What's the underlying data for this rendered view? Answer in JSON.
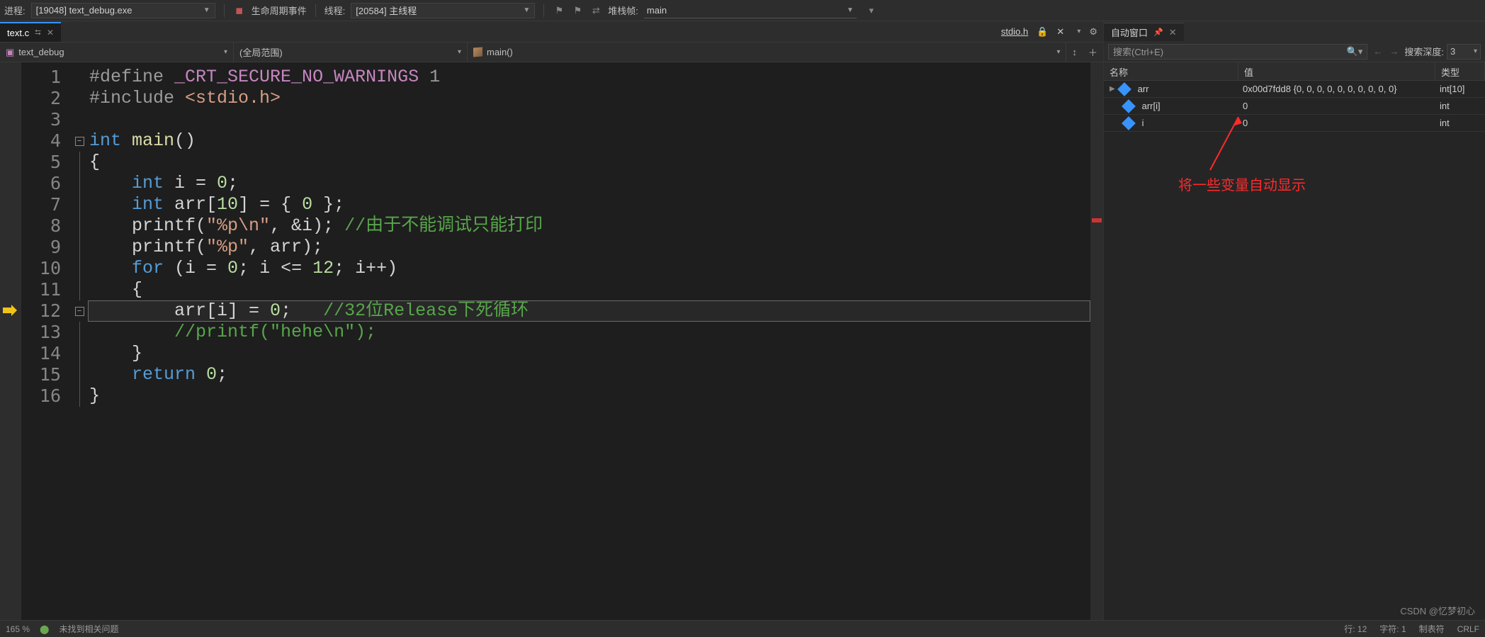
{
  "toolbar": {
    "process_label": "进程:",
    "process_value": "[19048] text_debug.exe",
    "lifecycle_label": "生命周期事件",
    "thread_label": "线程:",
    "thread_value": "[20584] 主线程",
    "stack_label": "堆栈帧:",
    "stack_value": "main"
  },
  "tab": {
    "filename": "text.c",
    "right_file": "stdio.h"
  },
  "nav": {
    "project": "text_debug",
    "scope": "(全局范围)",
    "func": "main()"
  },
  "code": {
    "lines": [
      {
        "n": "1"
      },
      {
        "n": "2"
      },
      {
        "n": "3"
      },
      {
        "n": "4"
      },
      {
        "n": "5"
      },
      {
        "n": "6"
      },
      {
        "n": "7"
      },
      {
        "n": "8"
      },
      {
        "n": "9"
      },
      {
        "n": "10"
      },
      {
        "n": "11"
      },
      {
        "n": "12"
      },
      {
        "n": "13"
      },
      {
        "n": "14"
      },
      {
        "n": "15"
      },
      {
        "n": "16"
      }
    ],
    "l1_a": "#define ",
    "l1_b": "_CRT_SECURE_NO_WARNINGS",
    "l1_c": " 1",
    "l2_a": "#include ",
    "l2_b": "<stdio.h>",
    "l4_a": "int",
    "l4_b": " main",
    "l4_c": "()",
    "l5": "{",
    "l6_a": "    ",
    "l6_b": "int",
    "l6_c": " i = ",
    "l6_d": "0",
    "l6_e": ";",
    "l7_a": "    ",
    "l7_b": "int",
    "l7_c": " arr[",
    "l7_d": "10",
    "l7_e": "] = { ",
    "l7_f": "0",
    "l7_g": " };",
    "l8_a": "    printf(",
    "l8_b": "\"%p\\n\"",
    "l8_c": ", &i); ",
    "l8_d": "//由于不能调试只能打印",
    "l9_a": "    printf(",
    "l9_b": "\"%p\"",
    "l9_c": ", arr);",
    "l10_a": "    ",
    "l10_b": "for",
    "l10_c": " (i = ",
    "l10_d": "0",
    "l10_e": "; i <= ",
    "l10_f": "12",
    "l10_g": "; i++)",
    "l11": "    {",
    "l12_a": "        arr[i] = ",
    "l12_b": "0",
    "l12_c": ";   ",
    "l12_d": "//32位Release下死循环",
    "l13_a": "        ",
    "l13_b": "//printf(\"hehe\\n\");",
    "l14": "    }",
    "l15_a": "    ",
    "l15_b": "return",
    "l15_c": " ",
    "l15_d": "0",
    "l15_e": ";",
    "l16": "}"
  },
  "autos": {
    "title": "自动窗口",
    "search_ph": "搜索(Ctrl+E)",
    "depth_label": "搜索深度:",
    "depth_value": "3",
    "cols": {
      "name": "名称",
      "value": "值",
      "type": "类型"
    },
    "rows": [
      {
        "expand": true,
        "name": "arr",
        "value": "0x00d7fdd8 {0, 0, 0, 0, 0, 0, 0, 0, 0, 0}",
        "type": "int[10]"
      },
      {
        "expand": false,
        "name": "arr[i]",
        "value": "0",
        "type": "int"
      },
      {
        "expand": false,
        "name": "i",
        "value": "0",
        "type": "int"
      }
    ]
  },
  "annotation": "将一些变量自动显示",
  "status": {
    "zoom": "165 %",
    "issues": "未找到相关问题",
    "line": "行: 12",
    "col": "字符: 1",
    "tabs": "制表符",
    "eol": "CRLF"
  },
  "watermark": "CSDN @忆梦初心"
}
